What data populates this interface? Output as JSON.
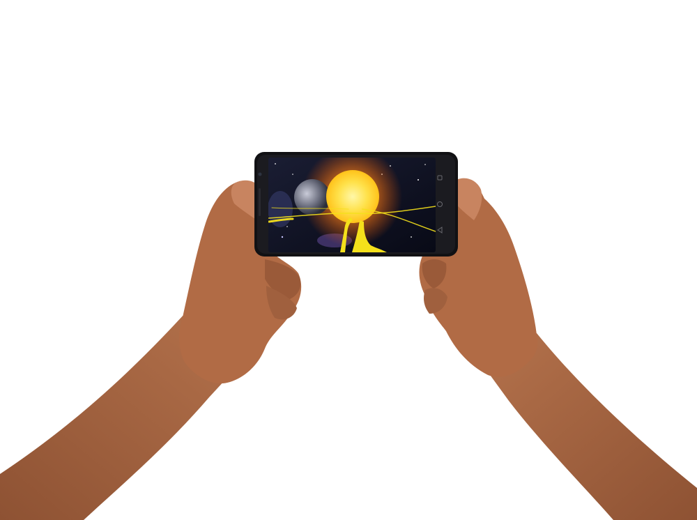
{
  "scene": {
    "subject": "hands-holding-phone",
    "background_color": "#ffffff",
    "skin_color": "#b26a45",
    "skin_shadow_color": "#8a4a2c",
    "phone_body_color": "#111114",
    "screen_sun_color": "#ffe14a",
    "screen_glow_color": "#ff9a1a",
    "screen_space_color": "#0b0e1f",
    "path_color": "#f4e01b"
  }
}
